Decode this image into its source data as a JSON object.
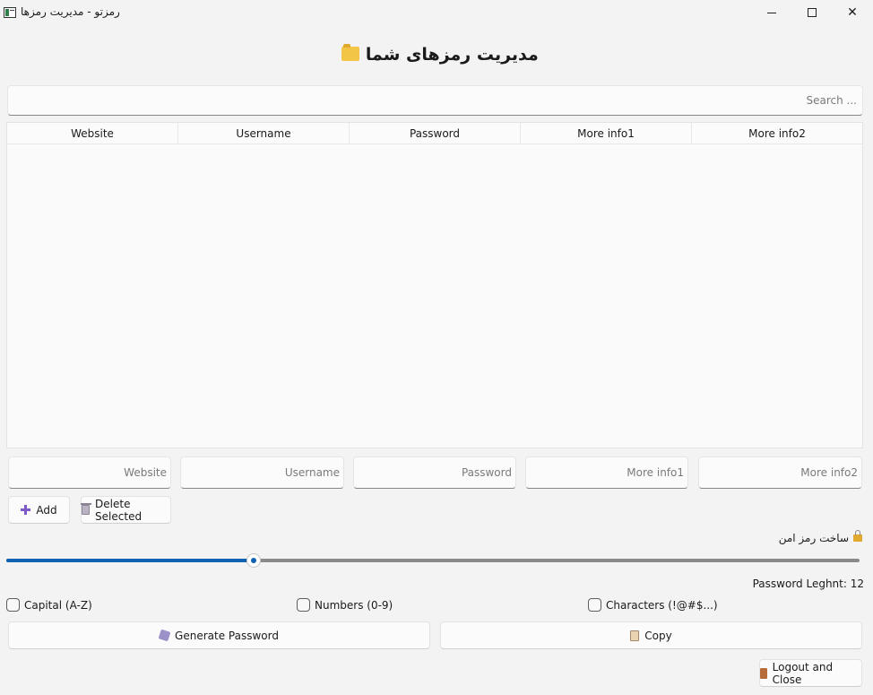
{
  "window": {
    "title": "رمزتو - مدیریت رمزها",
    "minimize_glyph": "",
    "close_glyph": "✕"
  },
  "heading": "مدیریت رمزهای شما",
  "search": {
    "placeholder": "Search ..."
  },
  "table": {
    "columns": [
      "Website",
      "Username",
      "Password",
      "More info1",
      "More info2"
    ],
    "rows": []
  },
  "fields": {
    "website": "Website",
    "username": "Username",
    "password": "Password",
    "more_info1": "More info1",
    "more_info2": "More info2"
  },
  "buttons": {
    "add": "Add",
    "delete_selected": "Delete Selected",
    "generate": "Generate Password",
    "copy": "Copy",
    "logout": "Logout and Close"
  },
  "generator": {
    "section_label": "ساخت رمز امن",
    "length_label": "Password Leghnt: 12",
    "length_value": 12,
    "slider_fraction": 0.29,
    "accent_color": "#0f62b1"
  },
  "options": {
    "capital": {
      "label": "Capital (A-Z)",
      "checked": false
    },
    "numbers": {
      "label": "Numbers (0-9)",
      "checked": false
    },
    "characters": {
      "label": "Characters (!@#$...)",
      "checked": false
    }
  },
  "icons": {
    "app": "app-window-icon",
    "heading": "folder-icon",
    "add": "plus-icon",
    "delete": "trash-icon",
    "lock": "lock-icon",
    "generate": "dice-icon",
    "copy": "clipboard-icon",
    "logout": "door-icon"
  }
}
